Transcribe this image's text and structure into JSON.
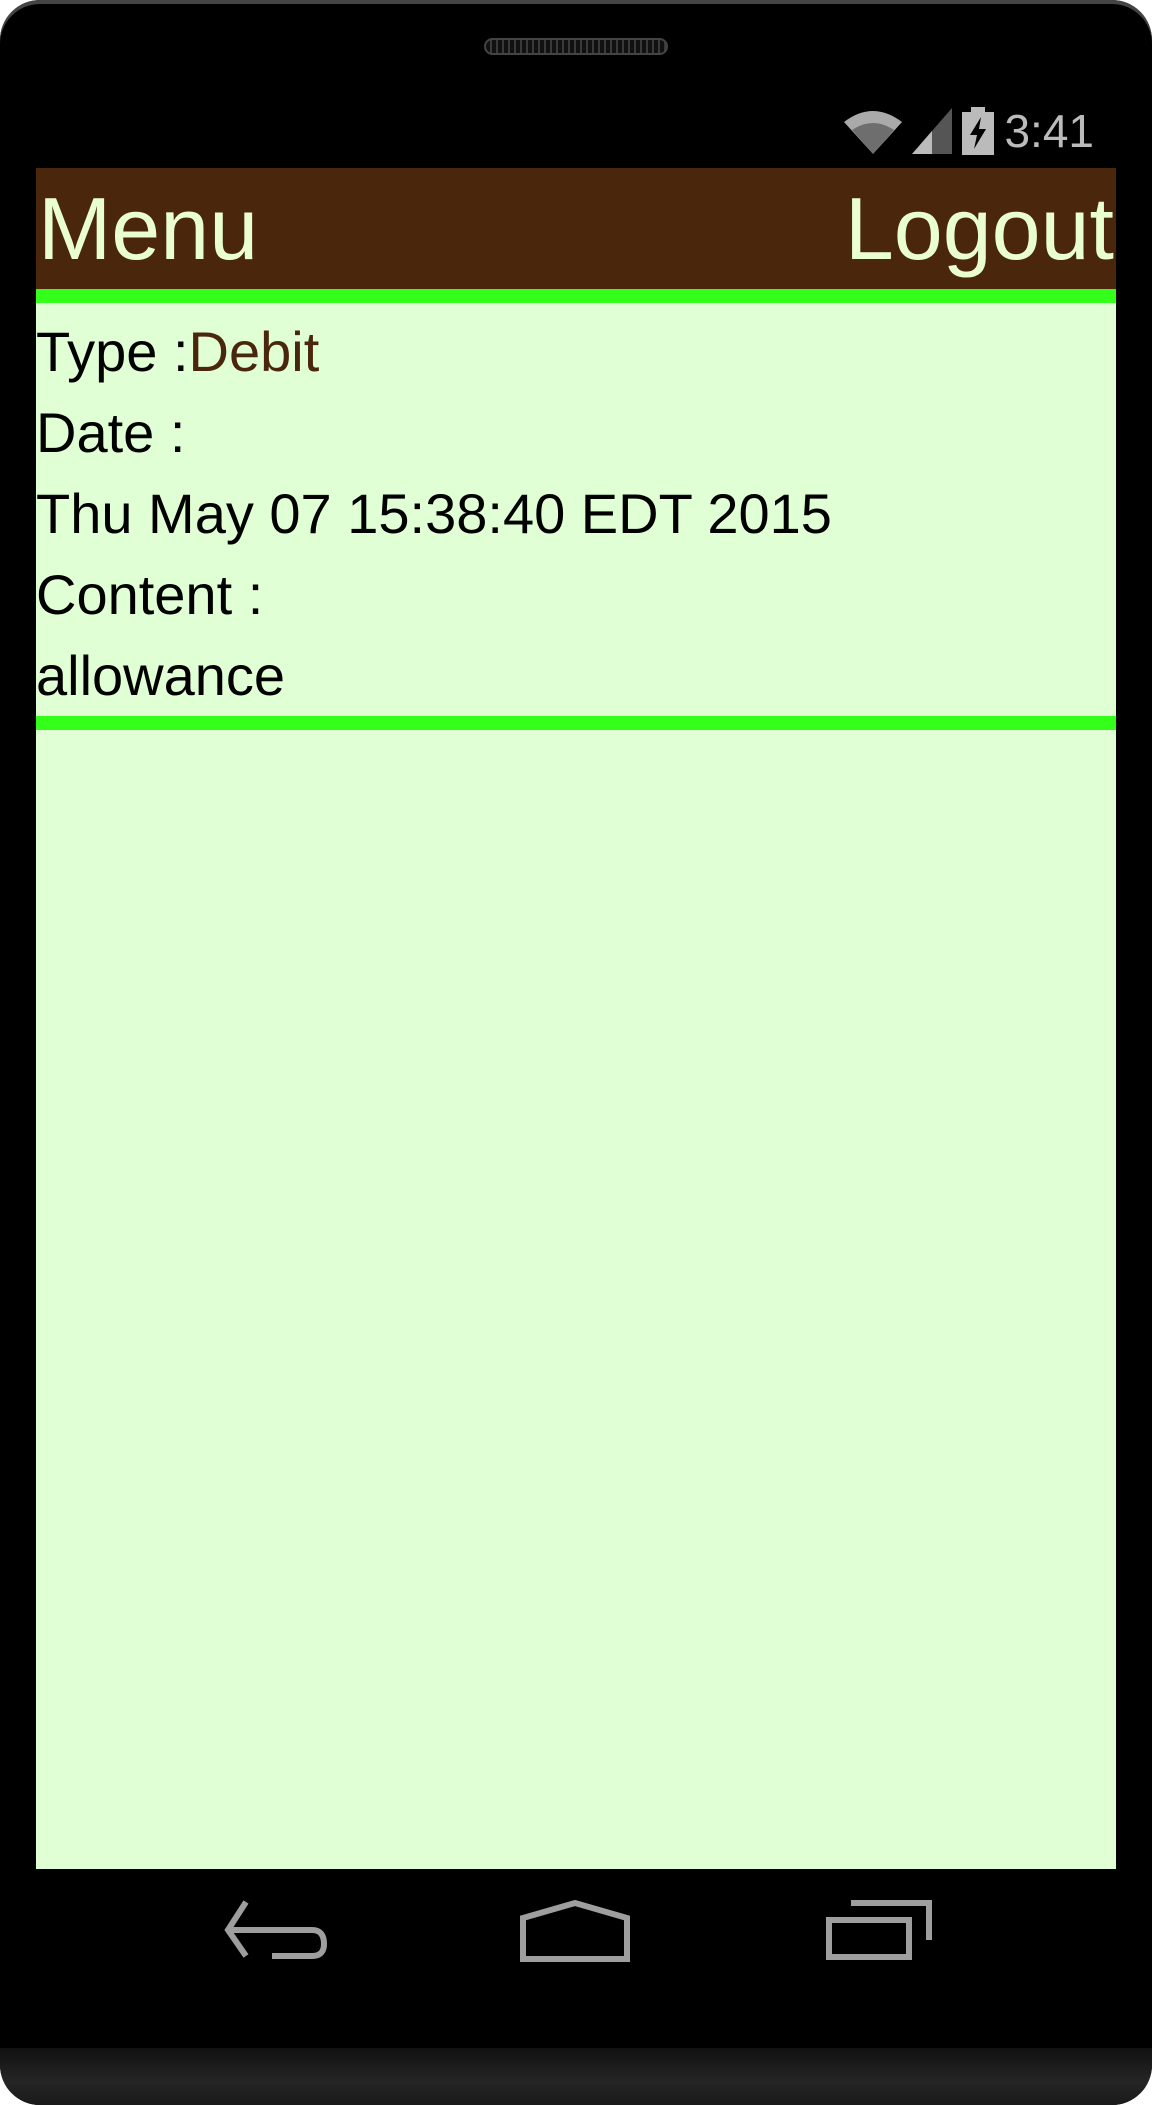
{
  "status_bar": {
    "time": "3:41",
    "icons": [
      "wifi-icon",
      "signal-icon",
      "battery-charging-icon"
    ]
  },
  "header": {
    "menu_label": "Menu",
    "logout_label": "Logout"
  },
  "detail": {
    "type_label": "Type :",
    "type_value": "Debit",
    "date_label": "Date :",
    "date_value": "Thu May 07 15:38:40 EDT 2015",
    "content_label": "Content :",
    "content_value": "allowance"
  },
  "colors": {
    "header_bg": "#4a260c",
    "accent_green": "#33ff1a",
    "screen_bg": "#e0ffd4",
    "header_text": "#eaffcf"
  },
  "nav_bar": {
    "icons": [
      "back-icon",
      "home-icon",
      "recents-icon"
    ]
  }
}
